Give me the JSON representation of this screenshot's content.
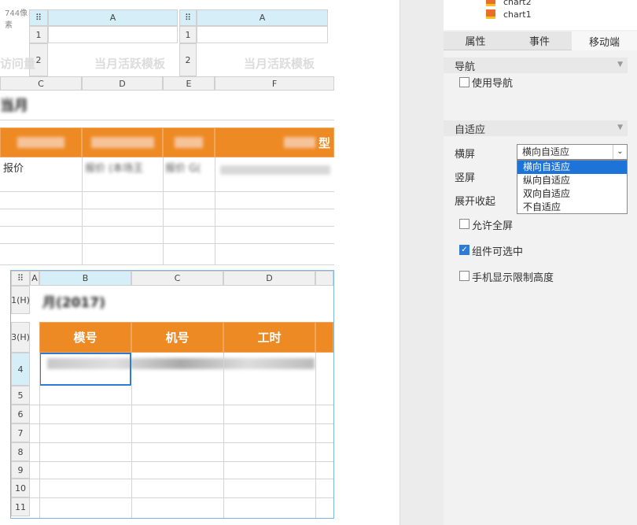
{
  "canvas": {
    "top_block": {
      "tag": "744像素",
      "col_a_left": "A",
      "col_a_right": "A",
      "row_nums": [
        "1",
        "2"
      ],
      "watermark_left": "访问量",
      "watermark_center": "当月活跃模板",
      "watermark_right": "当月活跃模板"
    },
    "mid_cols": [
      "C",
      "D",
      "E",
      "F"
    ],
    "mid_title": "当月",
    "mid_orange_right": "型",
    "mid_row_text": [
      "报价",
      "报价 (本场王",
      "报价 G("
    ],
    "report": {
      "cols": [
        "A",
        "B",
        "C",
        "D"
      ],
      "rows": [
        "1(H)",
        "3(H)",
        "4",
        "5",
        "6",
        "7",
        "8",
        "9",
        "10",
        "11"
      ],
      "title": "月(2017)",
      "headers": [
        "模号",
        "机号",
        "工时"
      ]
    }
  },
  "tree": {
    "items": [
      "chart2",
      "chart1"
    ]
  },
  "panel": {
    "tabs": [
      "属性",
      "事件",
      "移动端"
    ],
    "active_tab": 2,
    "nav_section": "导航",
    "use_nav": "使用导航",
    "adapt_section": "自适应",
    "landscape_label": "横屏",
    "portrait_label": "竖屏",
    "expand_label": "展开收起",
    "landscape_value": "横向自适应",
    "dropdown_options": [
      "横向自适应",
      "纵向自适应",
      "双向自适应",
      "不自适应"
    ],
    "allow_fullscreen": "允许全屏",
    "selectable": "组件可选中",
    "limit_height": "手机显示限制高度"
  },
  "colors": {
    "accent": "#ee8a24",
    "selection": "#2e7bd6",
    "highlight": "#1e73d8"
  }
}
